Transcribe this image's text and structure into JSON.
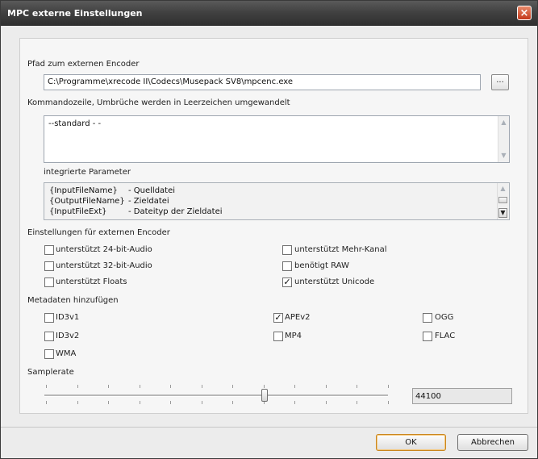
{
  "window": {
    "title": "MPC externe Einstellungen",
    "close_glyph": "×"
  },
  "path": {
    "label": "Pfad zum externen Encoder",
    "value": "C:\\Programme\\xrecode II\\Codecs\\Musepack SV8\\mpcenc.exe",
    "browse_label": "..."
  },
  "command": {
    "label": "Kommandozeile, Umbrüche werden in Leerzeichen umgewandelt",
    "value": "--standard - -"
  },
  "params": {
    "label": "integrierte Parameter",
    "rows": [
      {
        "name": "{InputFileName}",
        "desc": "- Quelldatei"
      },
      {
        "name": "{OutputFileName}",
        "desc": "- Zieldatei"
      },
      {
        "name": "{InputFileExt}",
        "desc": "- Dateityp der Zieldatei"
      }
    ]
  },
  "encoder_settings": {
    "label": "Einstellungen für externen Encoder",
    "options": [
      {
        "label": "unterstützt 24-bit-Audio",
        "checked": false
      },
      {
        "label": "unterstützt 32-bit-Audio",
        "checked": false
      },
      {
        "label": "unterstützt Floats",
        "checked": false
      },
      {
        "label": "unterstützt Mehr-Kanal",
        "checked": false
      },
      {
        "label": "benötigt RAW",
        "checked": false
      },
      {
        "label": "unterstützt Unicode",
        "checked": true
      }
    ]
  },
  "metadata": {
    "label": "Metadaten hinzufügen",
    "options": [
      {
        "label": "ID3v1",
        "checked": false
      },
      {
        "label": "ID3v2",
        "checked": false
      },
      {
        "label": "WMA",
        "checked": false
      },
      {
        "label": "APEv2",
        "checked": true
      },
      {
        "label": "MP4",
        "checked": false
      },
      {
        "label": "OGG",
        "checked": false
      },
      {
        "label": "FLAC",
        "checked": false
      }
    ]
  },
  "samplerate": {
    "label": "Samplerate",
    "value": "44100",
    "slider_position": 0.64
  },
  "buttons": {
    "ok": "OK",
    "cancel": "Abbrechen"
  },
  "check_glyph": "✓",
  "icons": {
    "close": "close-icon",
    "scroll_up": "scroll-up-icon",
    "scroll_down": "scroll-down-icon",
    "check": "check-icon"
  },
  "colors": {
    "titlebar": "#3f3f3f",
    "close_button": "#c4391c",
    "default_button_border": "#c9861f"
  }
}
